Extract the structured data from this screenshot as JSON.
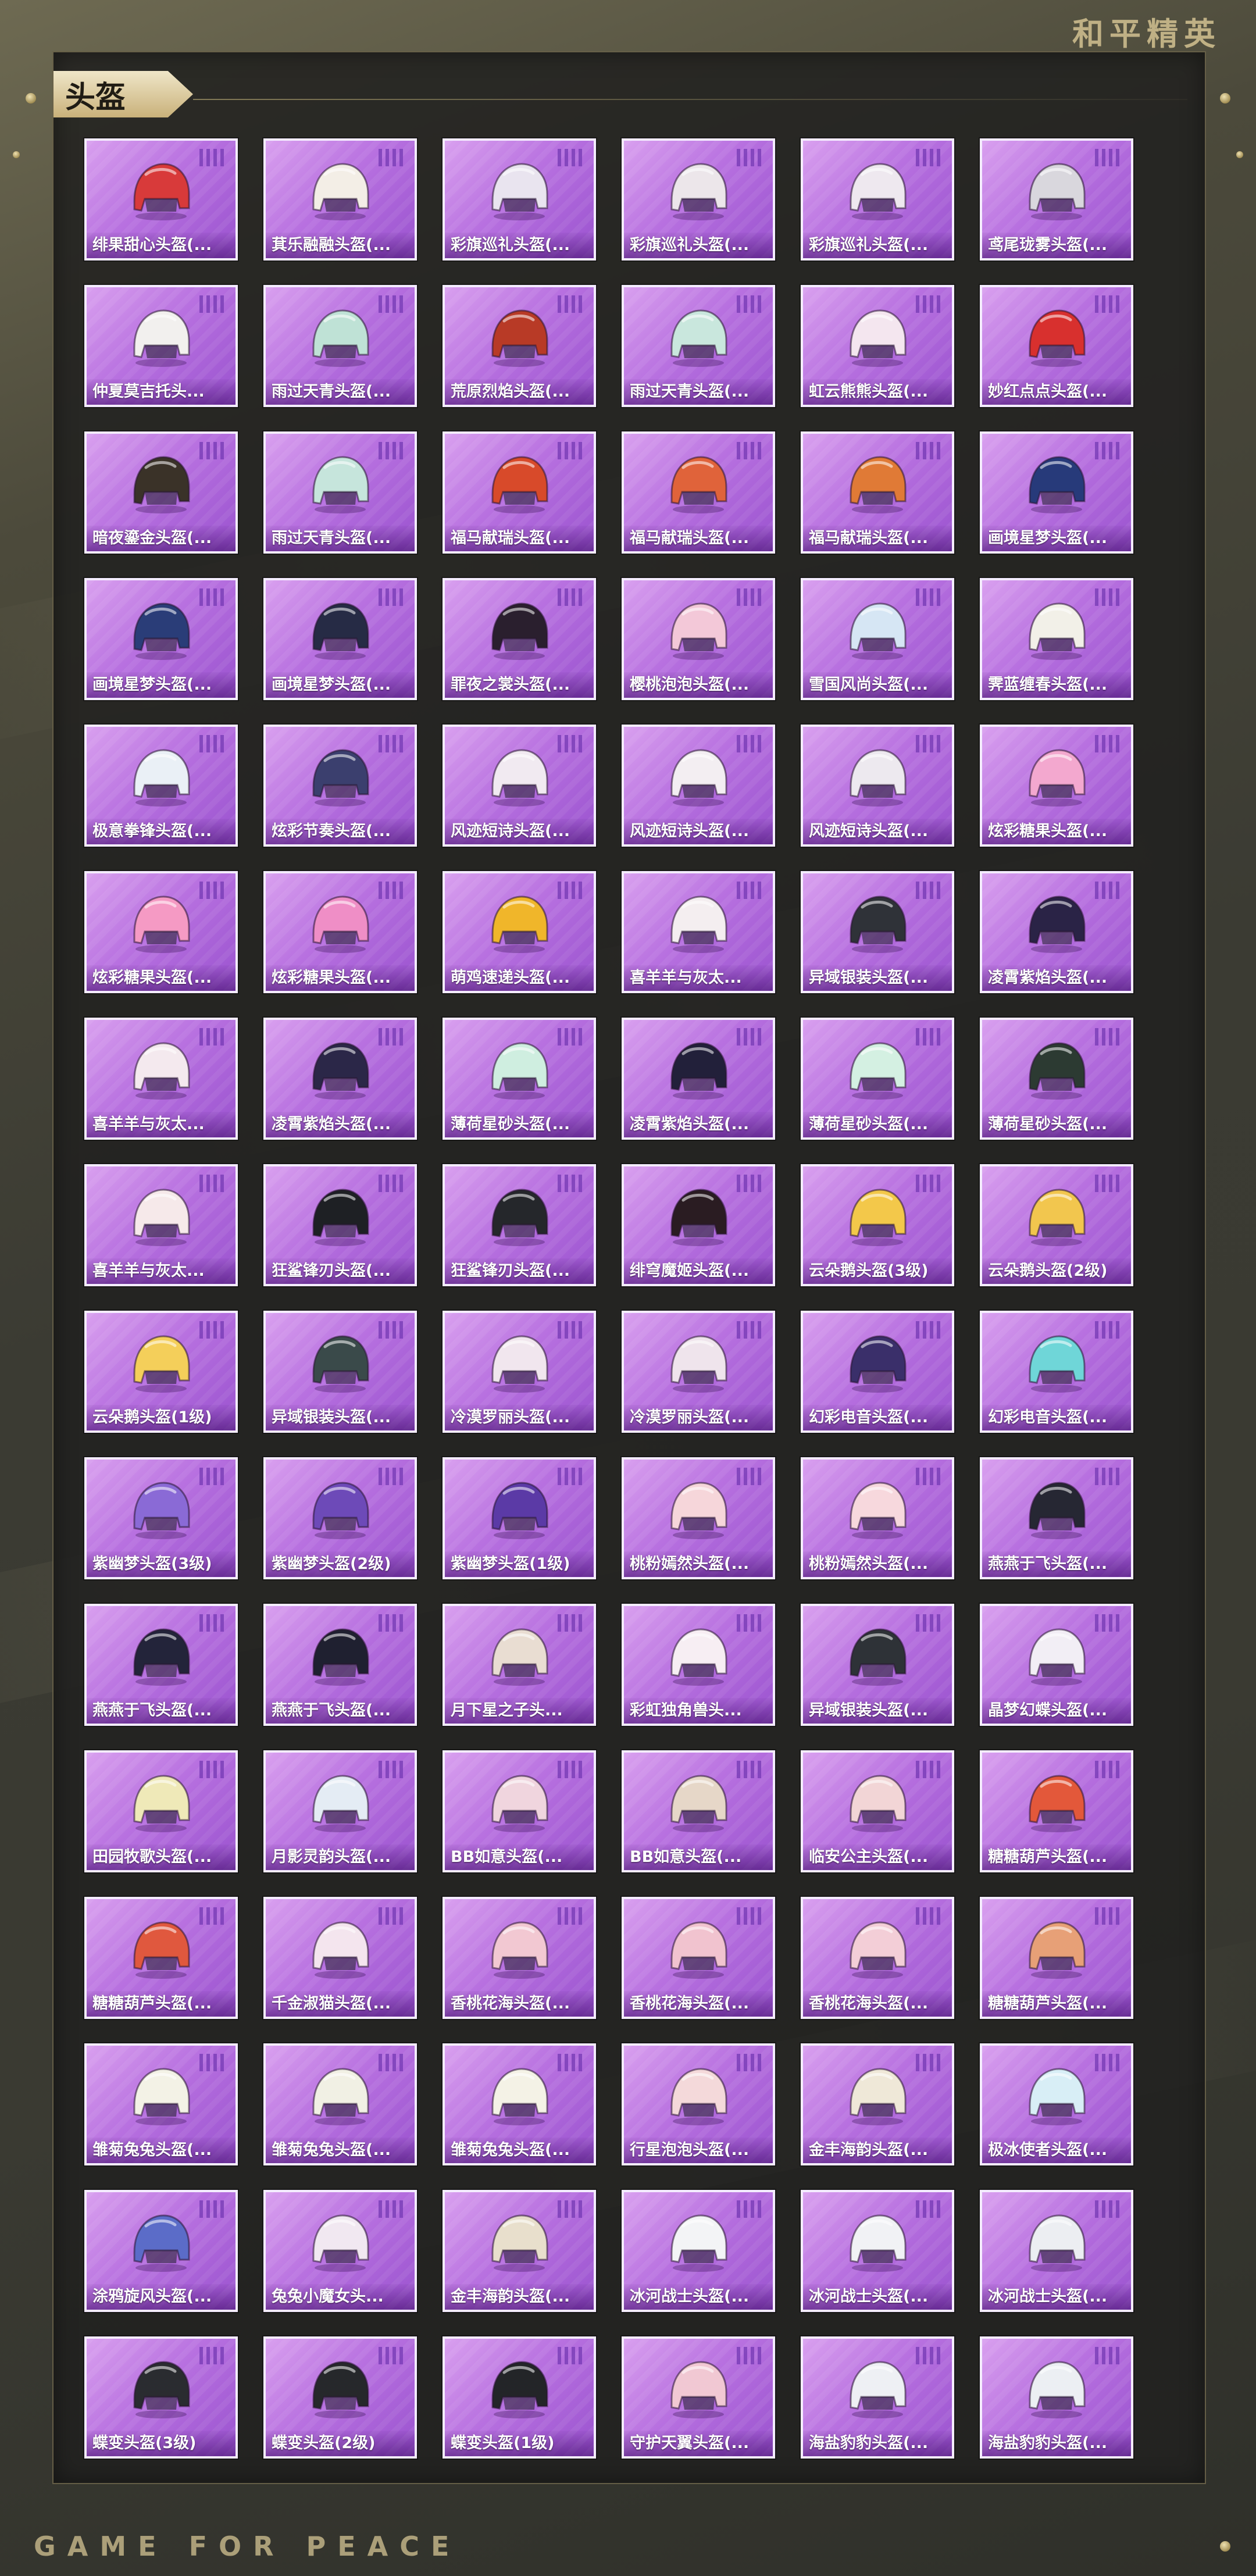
{
  "brand": {
    "cn_title": "和平精英",
    "en_title": "GAME FOR PEACE"
  },
  "section": {
    "title": "头盔"
  },
  "card_colors": {
    "border": "#f4ecff",
    "bg_light": "#d9a0ef",
    "bg_dark": "#9a53cf",
    "bars": "#7b3fb8"
  },
  "items": [
    {
      "label": "绯果甜心头盔(...",
      "color": "#d83a3a"
    },
    {
      "label": "萁乐融融头盔(...",
      "color": "#f3eee6"
    },
    {
      "label": "彩旗巡礼头盔(...",
      "color": "#e9e4ef"
    },
    {
      "label": "彩旗巡礼头盔(...",
      "color": "#ece6ea"
    },
    {
      "label": "彩旗巡礼头盔(...",
      "color": "#eee8ef"
    },
    {
      "label": "鸢尾珑雾头盔(...",
      "color": "#d9d7dd"
    },
    {
      "label": "仲夏莫吉托头...",
      "color": "#f2f0ee"
    },
    {
      "label": "雨过天青头盔(...",
      "color": "#bfe2d6"
    },
    {
      "label": "荒原烈焰头盔(...",
      "color": "#b83a26"
    },
    {
      "label": "雨过天青头盔(...",
      "color": "#c9e7dd"
    },
    {
      "label": "虹云熊熊头盔(...",
      "color": "#f4e6ef"
    },
    {
      "label": "妙红点点头盔(...",
      "color": "#d8302e"
    },
    {
      "label": "暗夜鎏金头盔(...",
      "color": "#3a3228"
    },
    {
      "label": "雨过天青头盔(...",
      "color": "#c6e5dc"
    },
    {
      "label": "福马献瑞头盔(...",
      "color": "#d84a2a"
    },
    {
      "label": "福马献瑞头盔(...",
      "color": "#e0633a"
    },
    {
      "label": "福马献瑞头盔(...",
      "color": "#e07a36"
    },
    {
      "label": "画境星梦头盔(...",
      "color": "#273a7a"
    },
    {
      "label": "画境星梦头盔(...",
      "color": "#2a3d78"
    },
    {
      "label": "画境星梦头盔(...",
      "color": "#262b45"
    },
    {
      "label": "罪夜之裳头盔(...",
      "color": "#2a1f2e"
    },
    {
      "label": "樱桃泡泡头盔(...",
      "color": "#f3c8d8"
    },
    {
      "label": "雪国风尚头盔(...",
      "color": "#d6e6f4"
    },
    {
      "label": "霁蓝缠春头盔(...",
      "color": "#f2f0e8"
    },
    {
      "label": "极意拳锋头盔(...",
      "color": "#eaf0f6"
    },
    {
      "label": "炫彩节奏头盔(...",
      "color": "#3b3f6e"
    },
    {
      "label": "风迹短诗头盔(...",
      "color": "#f1eaf1"
    },
    {
      "label": "风迹短诗头盔(...",
      "color": "#f3eef2"
    },
    {
      "label": "风迹短诗头盔(...",
      "color": "#ede9ef"
    },
    {
      "label": "炫彩糖果头盔(...",
      "color": "#f3a8cf"
    },
    {
      "label": "炫彩糖果头盔(...",
      "color": "#f59ac4"
    },
    {
      "label": "炫彩糖果头盔(...",
      "color": "#ef8ec6"
    },
    {
      "label": "萌鸡速递头盔(...",
      "color": "#f0b62a"
    },
    {
      "label": "喜羊羊与灰太...",
      "color": "#f4eef0"
    },
    {
      "label": "异域银装头盔(...",
      "color": "#2f3238"
    },
    {
      "label": "凌霄紫焰头盔(...",
      "color": "#2a2346"
    },
    {
      "label": "喜羊羊与灰太...",
      "color": "#f4e9ee"
    },
    {
      "label": "凌霄紫焰头盔(...",
      "color": "#2b2748"
    },
    {
      "label": "薄荷星砂头盔(...",
      "color": "#cfeee0"
    },
    {
      "label": "凌霄紫焰头盔(...",
      "color": "#22203a"
    },
    {
      "label": "薄荷星砂头盔(...",
      "color": "#d4f0e2"
    },
    {
      "label": "薄荷星砂头盔(...",
      "color": "#2c3a32"
    },
    {
      "label": "喜羊羊与灰太...",
      "color": "#f6e9ea"
    },
    {
      "label": "狂鲨锋刃头盔(...",
      "color": "#1e2024"
    },
    {
      "label": "狂鲨锋刃头盔(...",
      "color": "#25272b"
    },
    {
      "label": "绯穹魔姬头盔(...",
      "color": "#2a1c22"
    },
    {
      "label": "云朵鹅头盔(3级)",
      "color": "#f3c84a"
    },
    {
      "label": "云朵鹅头盔(2级)",
      "color": "#f2c64e"
    },
    {
      "label": "云朵鹅头盔(1级)",
      "color": "#f4cf5a"
    },
    {
      "label": "异域银装头盔(...",
      "color": "#3a4a4a"
    },
    {
      "label": "冷漠罗丽头盔(...",
      "color": "#f1e6ee"
    },
    {
      "label": "冷漠罗丽头盔(...",
      "color": "#efe4ec"
    },
    {
      "label": "幻彩电音头盔(...",
      "color": "#3a2f6a"
    },
    {
      "label": "幻彩电音头盔(...",
      "color": "#6fd6d8"
    },
    {
      "label": "紫幽梦头盔(3级)",
      "color": "#8a6ad6"
    },
    {
      "label": "紫幽梦头盔(2级)",
      "color": "#6d4ab8"
    },
    {
      "label": "紫幽梦头盔(1级)",
      "color": "#5b3aa6"
    },
    {
      "label": "桃粉嫣然头盔(...",
      "color": "#f6d6da"
    },
    {
      "label": "桃粉嫣然头盔(...",
      "color": "#f7d8dd"
    },
    {
      "label": "燕燕于飞头盔(...",
      "color": "#262733"
    },
    {
      "label": "燕燕于飞头盔(...",
      "color": "#23243a"
    },
    {
      "label": "燕燕于飞头盔(...",
      "color": "#1f2030"
    },
    {
      "label": "月下星之子头...",
      "color": "#e9ddd2"
    },
    {
      "label": "彩虹独角兽头...",
      "color": "#f7eef3"
    },
    {
      "label": "异域银装头盔(...",
      "color": "#2e3237"
    },
    {
      "label": "晶梦幻蝶头盔(...",
      "color": "#f2eef5"
    },
    {
      "label": "田园牧歌头盔(...",
      "color": "#efe9b8"
    },
    {
      "label": "月影灵韵头盔(...",
      "color": "#e4ecf4"
    },
    {
      "label": "BB如意头盔(...",
      "color": "#f0d5de"
    },
    {
      "label": "BB如意头盔(...",
      "color": "#e6d7c8"
    },
    {
      "label": "临安公主头盔(...",
      "color": "#f2d5d6"
    },
    {
      "label": "糖糖葫芦头盔(...",
      "color": "#e3583a"
    },
    {
      "label": "糖糖葫芦头盔(...",
      "color": "#e0583e"
    },
    {
      "label": "千金淑猫头盔(...",
      "color": "#f4e5ee"
    },
    {
      "label": "香桃花海头盔(...",
      "color": "#f2c8d2"
    },
    {
      "label": "香桃花海头盔(...",
      "color": "#f1c3cf"
    },
    {
      "label": "香桃花海头盔(...",
      "color": "#f3ced7"
    },
    {
      "label": "糖糖葫芦头盔(...",
      "color": "#e7a077"
    },
    {
      "label": "雏菊兔兔头盔(...",
      "color": "#f3f2e6"
    },
    {
      "label": "雏菊兔兔头盔(...",
      "color": "#f1f0e4"
    },
    {
      "label": "雏菊兔兔头盔(...",
      "color": "#f4f2e6"
    },
    {
      "label": "行星泡泡头盔(...",
      "color": "#f4d9da"
    },
    {
      "label": "金丰海韵头盔(...",
      "color": "#efe8d8"
    },
    {
      "label": "极冰使者头盔(...",
      "color": "#d8eef6"
    },
    {
      "label": "涂鸦旋风头盔(...",
      "color": "#5b6cc8"
    },
    {
      "label": "兔兔小魔女头...",
      "color": "#f1e8f1"
    },
    {
      "label": "金丰海韵头盔(...",
      "color": "#e8dfcc"
    },
    {
      "label": "冰河战士头盔(...",
      "color": "#f3f4f6"
    },
    {
      "label": "冰河战士头盔(...",
      "color": "#f1f2f5"
    },
    {
      "label": "冰河战士头盔(...",
      "color": "#eceef2"
    },
    {
      "label": "蝶变头盔(3级)",
      "color": "#2a2c30"
    },
    {
      "label": "蝶变头盔(2级)",
      "color": "#26282b"
    },
    {
      "label": "蝶变头盔(1级)",
      "color": "#232528"
    },
    {
      "label": "守护天翼头盔(...",
      "color": "#f1c8d3"
    },
    {
      "label": "海盐豹豹头盔(...",
      "color": "#eef0f4"
    },
    {
      "label": "海盐豹豹头盔(...",
      "color": "#eceff3"
    }
  ]
}
